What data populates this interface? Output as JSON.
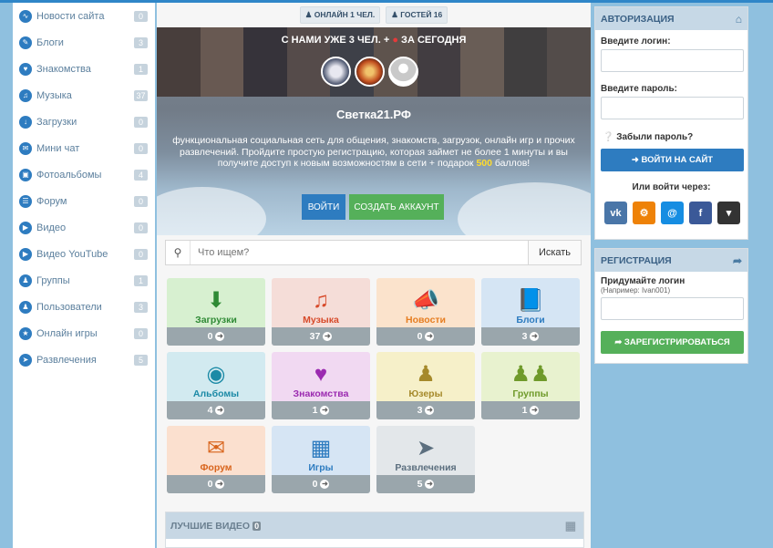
{
  "colors": {
    "accent": "#2e7cc0",
    "green": "#55b05a"
  },
  "sidebar": {
    "items": [
      {
        "label": "Новости сайта",
        "count": "0",
        "icon": "rss-icon"
      },
      {
        "label": "Блоги",
        "count": "3",
        "icon": "blog-icon"
      },
      {
        "label": "Знакомства",
        "count": "1",
        "icon": "heart-icon"
      },
      {
        "label": "Музыка",
        "count": "37",
        "icon": "music-icon"
      },
      {
        "label": "Загрузки",
        "count": "0",
        "icon": "download-icon"
      },
      {
        "label": "Мини чат",
        "count": "0",
        "icon": "chat-icon"
      },
      {
        "label": "Фотоальбомы",
        "count": "4",
        "icon": "photo-icon"
      },
      {
        "label": "Форум",
        "count": "0",
        "icon": "forum-icon"
      },
      {
        "label": "Видео",
        "count": "0",
        "icon": "video-icon"
      },
      {
        "label": "Видео YouTube",
        "count": "0",
        "icon": "youtube-icon"
      },
      {
        "label": "Группы",
        "count": "1",
        "icon": "group-icon"
      },
      {
        "label": "Пользователи",
        "count": "3",
        "icon": "users-icon"
      },
      {
        "label": "Онлайн игры",
        "count": "0",
        "icon": "games-icon"
      },
      {
        "label": "Развлечения",
        "count": "5",
        "icon": "rocket-icon"
      }
    ]
  },
  "online": {
    "online_label": "ОНЛАЙН 1 ЧЕЛ.",
    "guests_label": "ГОСТЕЙ 16"
  },
  "banner": {
    "title_part1": "С НАМИ УЖЕ 3 ЧЕЛ. +",
    "title_part2": "ЗА СЕГОДНЯ",
    "site_name": "Светка21.РФ",
    "desc_part1": "функциональная социальная сеть для общения, знакомств, загрузок, онлайн игр и прочих развлечений. Пройдите простую регистрацию, которая займет не более 1 минуты и вы получите доступ к новым возможностям в сети + подарок ",
    "bonus": "500",
    "desc_part2": " баллов!",
    "login_btn": "ВОЙТИ",
    "create_btn": "СОЗДАТЬ АККАУНТ"
  },
  "search": {
    "placeholder": "Что ищем?",
    "button": "Искать"
  },
  "tiles": [
    {
      "label": "Загрузки",
      "count": "0",
      "icon": "download-icon"
    },
    {
      "label": "Музыка",
      "count": "37",
      "icon": "music-icon"
    },
    {
      "label": "Новости",
      "count": "0",
      "icon": "megaphone-icon"
    },
    {
      "label": "Блоги",
      "count": "3",
      "icon": "book-icon"
    },
    {
      "label": "Альбомы",
      "count": "4",
      "icon": "camera-icon"
    },
    {
      "label": "Знакомства",
      "count": "1",
      "icon": "heart-icon"
    },
    {
      "label": "Юзеры",
      "count": "3",
      "icon": "user-icon"
    },
    {
      "label": "Группы",
      "count": "1",
      "icon": "group-icon"
    },
    {
      "label": "Форум",
      "count": "0",
      "icon": "comments-icon"
    },
    {
      "label": "Игры",
      "count": "0",
      "icon": "cubes-icon"
    },
    {
      "label": "Развлечения",
      "count": "5",
      "icon": "rocket-icon"
    }
  ],
  "videos": {
    "title": "ЛУЧШИЕ ВИДЕО",
    "count": "0"
  },
  "auth": {
    "title": "АВТОРИЗАЦИЯ",
    "login_label": "Введите логин:",
    "password_label": "Введите пароль:",
    "forgot": "Забыли пароль?",
    "submit": "ВОЙТИ НА САЙТ",
    "or_via": "Или войти через:"
  },
  "register": {
    "title": "РЕГИСТРАЦИЯ",
    "login_label": "Придумайте логин",
    "hint": "(Например: Ivan001)",
    "submit": "ЗАРЕГИСТРИРОВАТЬСЯ"
  }
}
